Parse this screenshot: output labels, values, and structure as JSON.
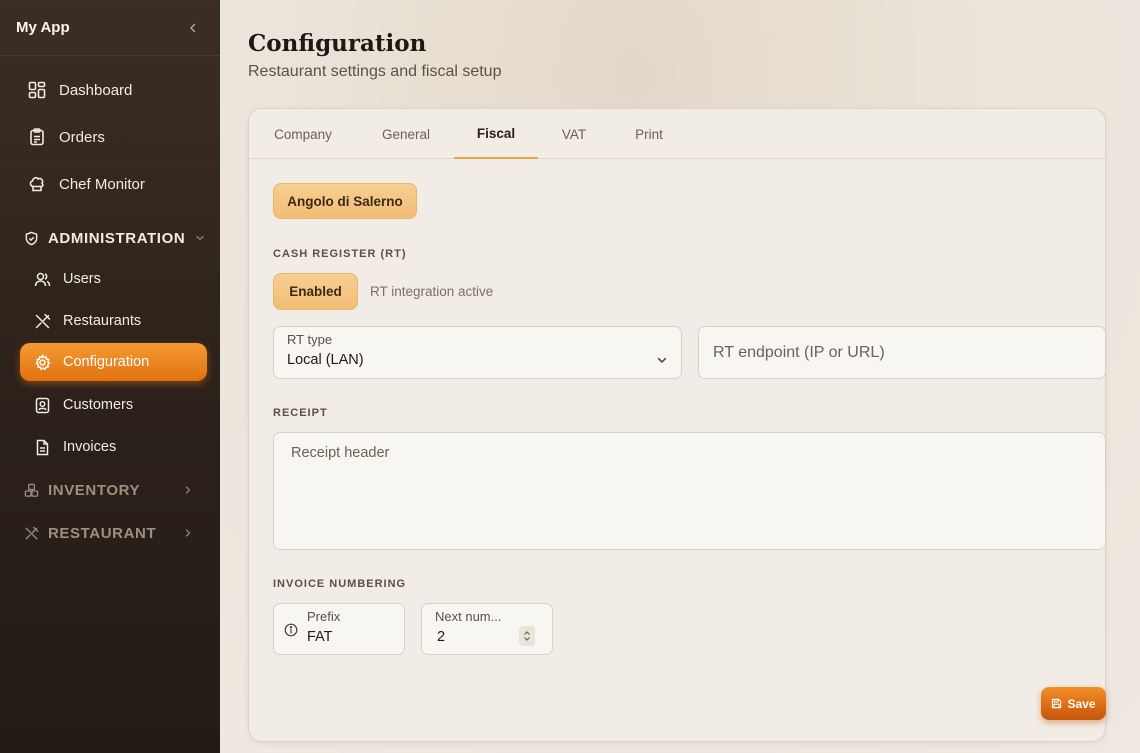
{
  "app": {
    "title": "My App"
  },
  "sidebar": {
    "items": [
      {
        "label": "Dashboard",
        "icon": "dashboard-grid-icon"
      },
      {
        "label": "Orders",
        "icon": "clipboard-icon"
      },
      {
        "label": "Chef Monitor",
        "icon": "chef-hat-icon"
      }
    ],
    "administration": {
      "label": "ADMINISTRATION",
      "icon": "shield-icon",
      "expanded": true,
      "items": [
        {
          "label": "Users",
          "icon": "users-icon"
        },
        {
          "label": "Restaurants",
          "icon": "utensils-icon"
        },
        {
          "label": "Configuration",
          "icon": "gear-icon",
          "active": true
        },
        {
          "label": "Customers",
          "icon": "contact-card-icon"
        },
        {
          "label": "Invoices",
          "icon": "document-icon"
        }
      ]
    },
    "inventory": {
      "label": "INVENTORY",
      "icon": "boxes-icon"
    },
    "restaurant": {
      "label": "RESTAURANT",
      "icon": "utensils-icon"
    }
  },
  "page": {
    "title": "Configuration",
    "subtitle": "Restaurant settings and fiscal setup"
  },
  "tabs": [
    {
      "label": "Company"
    },
    {
      "label": "General"
    },
    {
      "label": "Fiscal",
      "active": true
    },
    {
      "label": "VAT"
    },
    {
      "label": "Print"
    }
  ],
  "fiscal": {
    "restaurant_chip": "Angolo di Salerno",
    "cash_register": {
      "section_label": "CASH REGISTER (RT)",
      "toggle_label": "Enabled",
      "status_text": "RT integration active",
      "rt_type": {
        "label": "RT type",
        "value": "Local (LAN)"
      },
      "rt_endpoint": {
        "placeholder": "RT endpoint (IP or URL)",
        "value": ""
      }
    },
    "receipt": {
      "section_label": "RECEIPT",
      "header": {
        "placeholder": "Receipt header",
        "value": ""
      }
    },
    "invoice_numbering": {
      "section_label": "INVOICE NUMBERING",
      "prefix": {
        "label": "Prefix",
        "value": "FAT"
      },
      "next_number": {
        "label": "Next num...",
        "value": "2"
      }
    }
  },
  "actions": {
    "save_label": "Save"
  },
  "colors": {
    "accent": "#e97f1c",
    "chip": "#f4c680",
    "sidebar_bg": "#2e231c"
  }
}
